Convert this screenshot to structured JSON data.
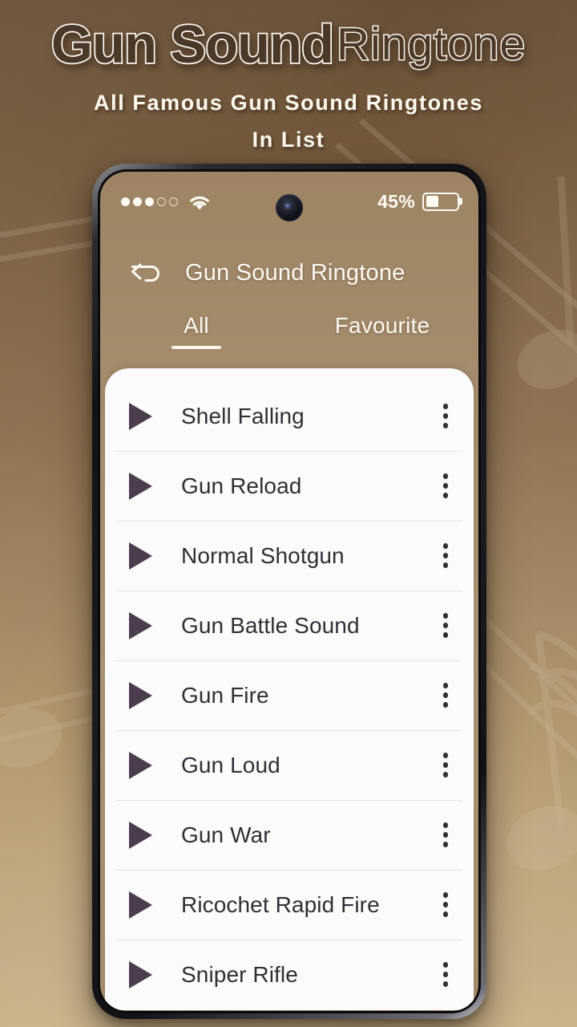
{
  "promo": {
    "title_bold": "Gun Sound",
    "title_light": "Ringtone",
    "subtitle_line1": "All Famous Gun Sound Ringtones",
    "subtitle_line2": "In List",
    "bg_gradient_top": "#6a5037",
    "bg_gradient_bottom": "#cab489",
    "title_fill": "#4a3828",
    "title_stroke": "#fdf8ef"
  },
  "status_bar": {
    "signal_icon": "signal-dots-icon",
    "signal_filled": 3,
    "signal_total": 5,
    "wifi_icon": "wifi-icon",
    "camera_icon": "front-camera-punch-hole",
    "battery_percent_label": "45%",
    "battery_level": 45,
    "battery_icon": "battery-icon"
  },
  "app_bar": {
    "back_icon": "back-arrow-icon",
    "title": "Gun Sound Ringtone"
  },
  "tabs": {
    "active_index": 0,
    "items": [
      {
        "label": "All"
      },
      {
        "label": "Favourite"
      }
    ]
  },
  "list": {
    "row_play_icon": "play-icon",
    "row_menu_icon": "more-vertical-icon",
    "play_icon_color": "#4b3c4e",
    "items": [
      {
        "name": "Shell Falling"
      },
      {
        "name": "Gun Reload"
      },
      {
        "name": "Normal Shotgun"
      },
      {
        "name": "Gun Battle Sound"
      },
      {
        "name": "Gun Fire"
      },
      {
        "name": "Gun Loud"
      },
      {
        "name": "Gun War"
      },
      {
        "name": "Ricochet Rapid Fire"
      },
      {
        "name": "Sniper Rifle"
      }
    ]
  }
}
